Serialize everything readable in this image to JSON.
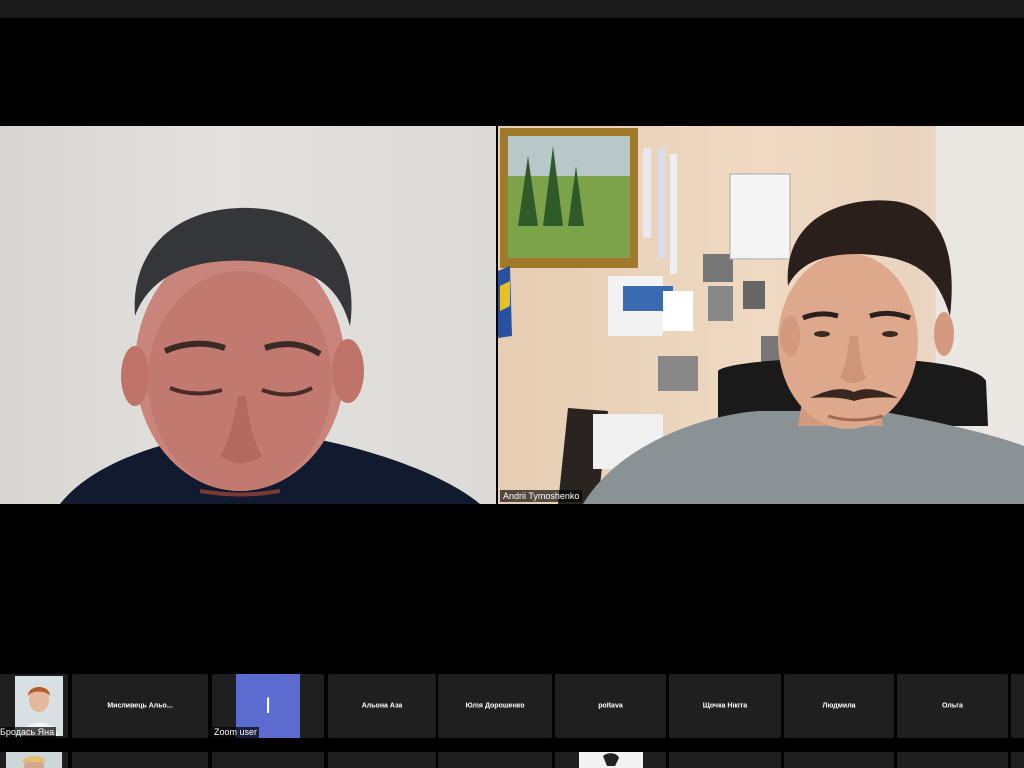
{
  "main_view": {
    "participants": [
      {
        "name": ""
      },
      {
        "name": "Andrii Tymoshenko"
      }
    ]
  },
  "gallery": {
    "row1": [
      {
        "name": "Бродась Яна",
        "type": "video"
      },
      {
        "name": "Мисливець Альо...",
        "type": "name"
      },
      {
        "name": "Zoom user",
        "type": "avatar",
        "initial": "I"
      },
      {
        "name": "Альона Аза",
        "type": "name"
      },
      {
        "name": "Юлія Дорошенко",
        "type": "name"
      },
      {
        "name": "poltava",
        "type": "name"
      },
      {
        "name": "Щочка Нікіта",
        "type": "name"
      },
      {
        "name": "Людмила",
        "type": "name"
      },
      {
        "name": "Ольга",
        "type": "name"
      }
    ]
  },
  "colors": {
    "avatar_bg": "#5b6bd0",
    "tile_bg": "#1f1f1f"
  }
}
